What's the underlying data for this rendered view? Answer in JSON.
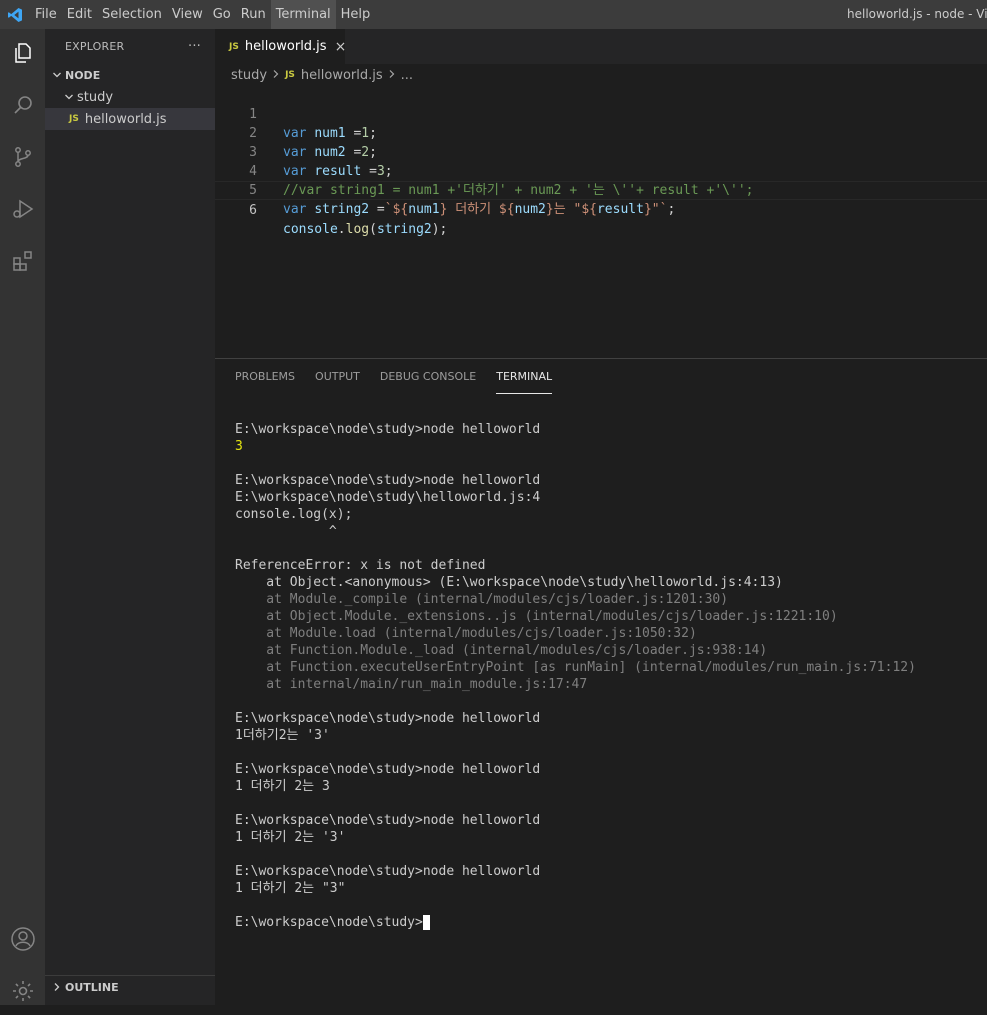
{
  "menu": [
    "File",
    "Edit",
    "Selection",
    "View",
    "Go",
    "Run",
    "Terminal",
    "Help"
  ],
  "window_title": "helloworld.js - node - Visual Studio Code",
  "sidebar": {
    "title": "EXPLORER",
    "more": "···",
    "root": "NODE",
    "folder": "study",
    "file": "helloworld.js",
    "file_badge": "JS",
    "outline": "OUTLINE"
  },
  "tab": {
    "label": "helloworld.js",
    "badge": "JS",
    "close": "×"
  },
  "breadcrumb": {
    "folder": "study",
    "file": "helloworld.js",
    "badge": "JS",
    "ellipsis": "..."
  },
  "code": {
    "line_numbers": [
      "1",
      "2",
      "3",
      "4",
      "5",
      "6"
    ],
    "l1": {
      "kw": "var",
      "name": "num1",
      "op": " =",
      "val": "1",
      "end": ";"
    },
    "l2": {
      "kw": "var",
      "name": "num2",
      "op": " =",
      "val": "2",
      "end": ";"
    },
    "l3": {
      "kw": "var",
      "name": "result",
      "op": " =",
      "val": "3",
      "end": ";"
    },
    "l4": "//var string1 = num1 +'더하기' + num2 + '는 \\''+ result +'\\'';",
    "l5": {
      "kw": "var",
      "name": "string2",
      "op": " =",
      "t1": "`${",
      "v1": "num1",
      "t2": "} 더하기 ${",
      "v2": "num2",
      "t3": "}는 \"${",
      "v3": "result",
      "t4": "}\"`",
      "end": ";"
    },
    "l6": {
      "obj": "console",
      "dot": ".",
      "fn": "log",
      "open": "(",
      "arg": "string2",
      "close": ");"
    }
  },
  "panel": {
    "tabs": [
      "PROBLEMS",
      "OUTPUT",
      "DEBUG CONSOLE",
      "TERMINAL"
    ],
    "active_tab": "TERMINAL",
    "terminal": {
      "prompt": "E:\\workspace\\node\\study>",
      "cmd": "node helloworld",
      "out1": "3",
      "err_file": "E:\\workspace\\node\\study\\helloworld.js:4",
      "err_code": "console.log(x);",
      "err_caret": "            ^",
      "err_msg": "ReferenceError: x is not defined",
      "stack": [
        "    at Object.<anonymous> (E:\\workspace\\node\\study\\helloworld.js:4:13)",
        "    at Module._compile (internal/modules/cjs/loader.js:1201:30)",
        "    at Object.Module._extensions..js (internal/modules/cjs/loader.js:1221:10)",
        "    at Module.load (internal/modules/cjs/loader.js:1050:32)",
        "    at Function.Module._load (internal/modules/cjs/loader.js:938:14)",
        "    at Function.executeUserEntryPoint [as runMain] (internal/modules/run_main.js:71:12)",
        "    at internal/main/run_main_module.js:17:47"
      ],
      "out3": "1더하기2는 '3'",
      "out4": "1 더하기 2는 3",
      "out5": "1 더하기 2는 '3'",
      "out6": "1 더하기 2는 \"3\""
    }
  },
  "colors": {
    "accent": "#007acc",
    "keyword": "#569cd6",
    "variable": "#9cdcfe",
    "number": "#b5cea8",
    "comment": "#6a9955",
    "string": "#ce9178",
    "function": "#dcdcaa"
  }
}
